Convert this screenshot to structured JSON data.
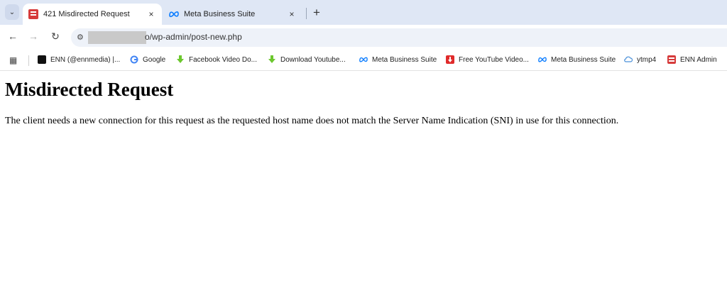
{
  "tabs": [
    {
      "title": "421 Misdirected Request",
      "close": "×",
      "favicon": "error-favicon"
    },
    {
      "title": "Meta Business Suite",
      "close": "×",
      "favicon": "meta-logo"
    }
  ],
  "newtab": "+",
  "tab_search": "⌄",
  "toolbar": {
    "back": "←",
    "forward": "→",
    "reload": "↻",
    "site_info": "⚙",
    "url": "o/wp-admin/post-new.php"
  },
  "bookmarks": [
    {
      "label": "ENN (@ennmedia) |...",
      "icon": "tiktok-icon"
    },
    {
      "label": "Google",
      "icon": "google-icon"
    },
    {
      "label": "Facebook Video Do...",
      "icon": "download-arrow-icon"
    },
    {
      "label": "Download Youtube...",
      "icon": "download-arrow-icon"
    },
    {
      "label": "Meta Business Suite",
      "icon": "meta-logo-icon"
    },
    {
      "label": "Free YouTube Video...",
      "icon": "red-download-icon"
    },
    {
      "label": "Meta Business Suite",
      "icon": "meta-logo-icon"
    },
    {
      "label": "ytmp4",
      "icon": "cloud-download-icon"
    },
    {
      "label": "ENN Admin",
      "icon": "enn-favicon"
    }
  ],
  "page": {
    "heading": "Misdirected Request",
    "message": "The client needs a new connection for this request as the requested host name does not match the Server Name Indication (SNI) in use for this connection."
  },
  "colors": {
    "tabstrip_bg": "#dfe7f5",
    "omnibox_bg": "#eef2f9",
    "meta_blue": "#0a7cff"
  }
}
